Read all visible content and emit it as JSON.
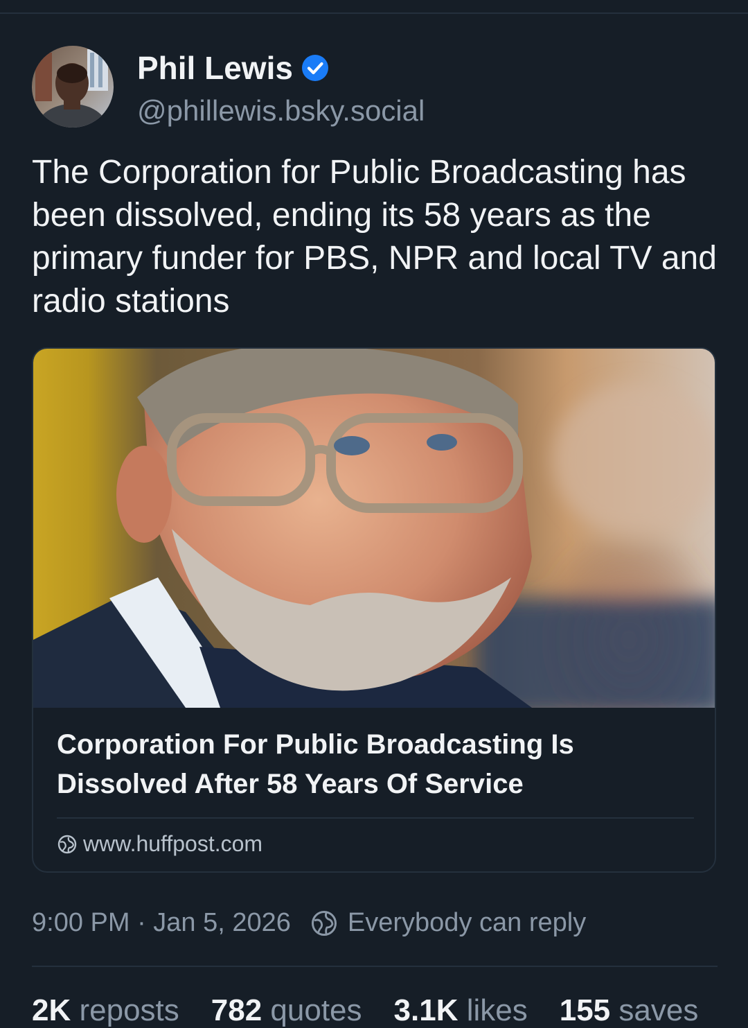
{
  "post": {
    "author": {
      "display_name": "Phil Lewis",
      "handle": "@phillewis.bsky.social",
      "verified": true
    },
    "text": "The Corporation for Public Broadcasting has been dissolved, ending its 58 years as the primary funder for PBS, NPR and local TV and radio stations",
    "link_card": {
      "title": "Corporation For Public Broadcasting Is Dissolved After 58 Years Of Service",
      "domain": "www.huffpost.com",
      "domain_icon": "globe-icon"
    },
    "timestamp": "9:00 PM · Jan 5, 2026",
    "reply_setting": "Everybody can reply",
    "reply_icon": "globe-icon",
    "stats": {
      "reposts": {
        "count": "2K",
        "label": "reposts"
      },
      "quotes": {
        "count": "782",
        "label": "quotes"
      },
      "likes": {
        "count": "3.1K",
        "label": "likes"
      },
      "saves": {
        "count": "155",
        "label": "saves"
      }
    }
  },
  "colors": {
    "background": "#161e27",
    "text_primary": "#f1f3f5",
    "text_secondary": "#8b98a7",
    "verified_badge": "#1a7cf7",
    "border": "#24303d"
  }
}
